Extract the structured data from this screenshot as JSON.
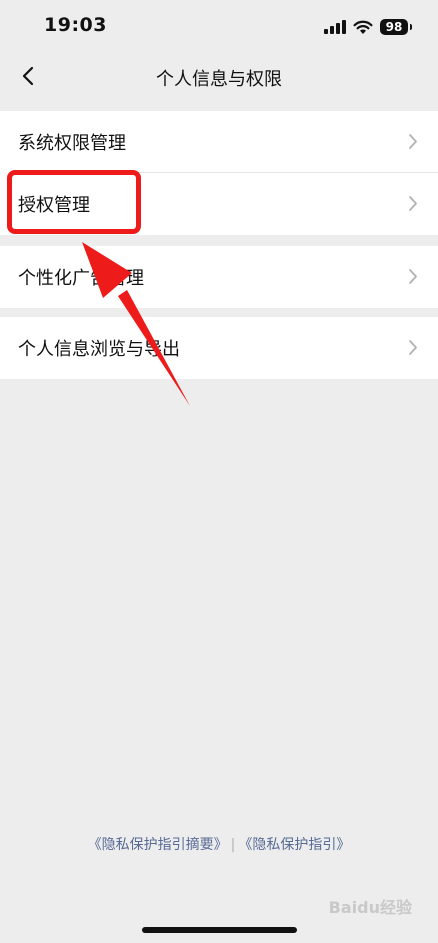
{
  "status_bar": {
    "time": "19:03",
    "battery": "98"
  },
  "nav": {
    "title": "个人信息与权限"
  },
  "groups": [
    {
      "items": [
        {
          "label": "系统权限管理"
        },
        {
          "label": "授权管理"
        }
      ]
    },
    {
      "items": [
        {
          "label": "个性化广告管理"
        }
      ]
    },
    {
      "items": [
        {
          "label": "个人信息浏览与导出"
        }
      ]
    }
  ],
  "footer": {
    "link_summary": "《隐私保护指引摘要》",
    "separator": "|",
    "link_full": "《隐私保护指引》"
  },
  "watermark": "Baidu经验",
  "colors": {
    "annotation": "#ee1b1b",
    "link": "#576b95",
    "background": "#ededed"
  }
}
